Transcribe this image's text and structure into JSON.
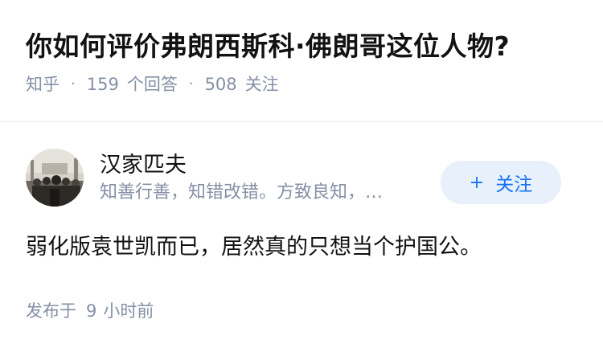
{
  "question": {
    "title": "你如何评价弗朗西斯科·佛朗哥这位人物?",
    "source": "知乎",
    "separator": "·",
    "answer_count": "159",
    "answer_label": "个回答",
    "follower_count": "508",
    "follower_label": "关注"
  },
  "answer": {
    "author_name": "汉家匹夫",
    "author_bio": "知善行善，知错改错。方致良知，…",
    "follow_plus": "+",
    "follow_label": "关注",
    "content": "弱化版袁世凯而已，居然真的只想当个护国公。",
    "published_prefix": "发布于",
    "published_num": "9",
    "published_suffix": "小时前"
  },
  "colors": {
    "muted_text": "#8590a6",
    "accent": "#1772f6",
    "follow_bg": "#e7f0fb"
  }
}
